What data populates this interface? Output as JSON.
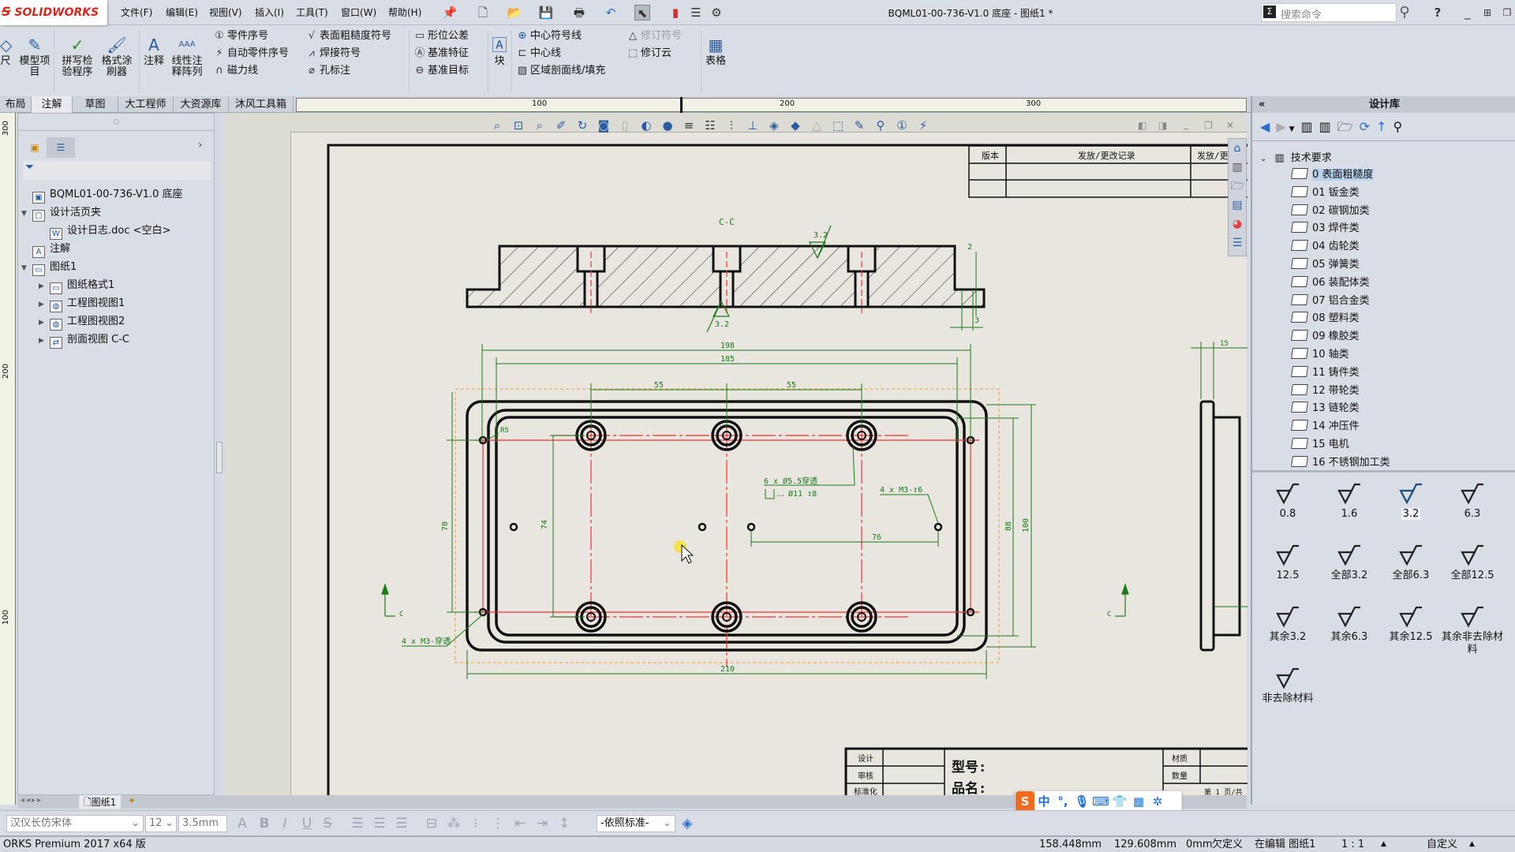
{
  "app": {
    "logo": "SOLIDWORKS",
    "window_title": "BQML01-00-736-V1.0 底座 - 图纸1 *",
    "search_placeholder": "搜索命令",
    "help": "?"
  },
  "menu": [
    "文件(F)",
    "编辑(E)",
    "视图(V)",
    "插入(I)",
    "工具(T)",
    "窗口(W)",
    "帮助(H)"
  ],
  "ribbon": {
    "big": [
      "尺",
      "模型项目",
      "拼写检验程序",
      "格式涂刷器",
      "注释",
      "线性注释阵列",
      "块",
      "表格"
    ],
    "col1": [
      "零件序号",
      "自动零件序号",
      "磁力线"
    ],
    "col2": [
      "表面粗糙度符号",
      "焊接符号",
      "孔标注"
    ],
    "col3": [
      "形位公差",
      "基准特征",
      "基准目标"
    ],
    "col4": [
      "中心符号线",
      "中心线",
      "区域剖面线/填充"
    ],
    "col5": [
      "修订符号",
      "修订云"
    ]
  },
  "tabs": [
    {
      "label": "布局",
      "active": false
    },
    {
      "label": "注解",
      "active": true
    },
    {
      "label": "草图",
      "active": false
    },
    {
      "label": "大工程师",
      "active": false
    },
    {
      "label": "大资源库",
      "active": false
    },
    {
      "label": "沐风工具箱",
      "active": false
    }
  ],
  "ruler": {
    "h": [
      "100",
      "200",
      "300"
    ],
    "v": [
      "300",
      "200",
      "100"
    ]
  },
  "feature_tree": [
    {
      "label": "BQML01-00-736-V1.0 底座",
      "level": 0,
      "toggle": "",
      "icon": "drawing-icon"
    },
    {
      "label": "设计活页夹",
      "level": 0,
      "toggle": "▼",
      "icon": "binder-icon"
    },
    {
      "label": "设计日志.doc <空白>",
      "level": 1,
      "toggle": "",
      "icon": "word-doc-icon"
    },
    {
      "label": "注解",
      "level": 0,
      "toggle": "",
      "icon": "annotation-folder-icon"
    },
    {
      "label": "图纸1",
      "level": 0,
      "toggle": "▼",
      "icon": "sheet-icon"
    },
    {
      "label": "图纸格式1",
      "level": 1,
      "toggle": "▶",
      "icon": "sheet-format-icon"
    },
    {
      "label": "工程图视图1",
      "level": 1,
      "toggle": "▶",
      "icon": "drawing-view-icon"
    },
    {
      "label": "工程图视图2",
      "level": 1,
      "toggle": "▶",
      "icon": "drawing-view-icon"
    },
    {
      "label": "剖面视图 C-C",
      "level": 1,
      "toggle": "▶",
      "icon": "section-view-icon"
    }
  ],
  "design_library": {
    "title": "设计库",
    "root": "技术要求",
    "folders": [
      "0 表面粗糙度",
      "01 钣金类",
      "02 碳钢加类",
      "03 焊件类",
      "04 齿轮类",
      "05 弹簧类",
      "06 装配体类",
      "07 铝合金类",
      "08 塑料类",
      "09 橡胶类",
      "10 轴类",
      "11 铸件类",
      "12 带轮类",
      "13 链轮类",
      "14 冲压件",
      "15 电机",
      "16 不锈钢加工类"
    ],
    "selected_folder": "0 表面粗糙度",
    "symbols": [
      "0.8",
      "1.6",
      "3.2",
      "6.3",
      "12.5",
      "全部3.2",
      "全部6.3",
      "全部12.5",
      "其余3.2",
      "其余6.3",
      "其余12.5",
      "其余非去除材料",
      "非去除材料"
    ],
    "selected_symbol": "3.2"
  },
  "drawing": {
    "section_label": "C-C",
    "roughness_top": "3.2",
    "roughness_bottom": "3.2",
    "dims": {
      "d198": "198",
      "d185": "185",
      "d55a": "55",
      "d55b": "55",
      "d210": "210",
      "d76": "76",
      "d74": "74",
      "d70": "70",
      "d88": "88",
      "d100": "100",
      "d15": "15",
      "d2": "2",
      "d3": "3",
      "r5": "R5"
    },
    "callouts": {
      "holes6_line1": "6 x Ø5.5穿透",
      "holes6_line2": "⌴ Ø11 ↧8",
      "m3_depth": "4 x M3-↧6",
      "m3_through": "4 x M3-穿透"
    },
    "section_marks": [
      "C",
      "C"
    ],
    "rev_table": {
      "headers": [
        "版本",
        "发放/更改记录",
        "发放/更改"
      ]
    },
    "title_block": {
      "rows": [
        "设计",
        "审核",
        "标准化"
      ],
      "model": "型号:",
      "name": "品名:",
      "material": "材质",
      "quantity": "数量",
      "sheet": "第 1 页/共"
    }
  },
  "sheet_tabs": {
    "active": "图纸1"
  },
  "format_bar": {
    "font": "汉仪长仿宋体",
    "size": "12",
    "height": "3.5mm",
    "standard": "-依照标准-"
  },
  "status": {
    "product": "ORKS Premium 2017 x64 版",
    "x": "158.448mm",
    "y": "129.608mm",
    "z": "0mm",
    "state": "欠定义",
    "editing": "在编辑 图纸1",
    "scale": "1 : 1",
    "units": "自定义"
  },
  "ime": {
    "mode": "中",
    "punct": "°,"
  }
}
